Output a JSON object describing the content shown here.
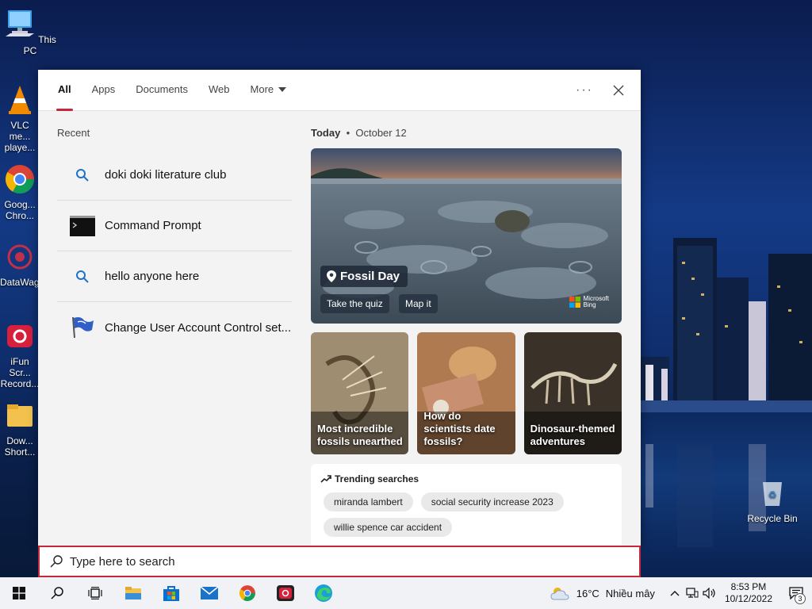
{
  "desktop": {
    "this_pc": "This PC",
    "vlc": "VLC me... playe...",
    "chrome": "Goog... Chro...",
    "datawag": "DataWag...",
    "ifun": "iFun Scr... Record...",
    "download": "Dow... Short...",
    "recycle_bin": "Recycle Bin"
  },
  "tabs": [
    {
      "label": "All"
    },
    {
      "label": "Apps"
    },
    {
      "label": "Documents"
    },
    {
      "label": "Web"
    },
    {
      "label": "More"
    }
  ],
  "recent": {
    "title": "Recent",
    "items": [
      {
        "label": "doki doki literature club",
        "icon": "search-icon"
      },
      {
        "label": "Command Prompt",
        "icon": "command-prompt-icon"
      },
      {
        "label": "hello anyone here",
        "icon": "search-icon"
      },
      {
        "label": "Change User Account Control set...",
        "icon": "uac-flag-icon"
      }
    ]
  },
  "today": {
    "label": "Today",
    "separator": "•",
    "date": "October 12"
  },
  "hero": {
    "title": "Fossil Day",
    "btn_quiz": "Take the quiz",
    "btn_map": "Map it",
    "bing_line1": "Microsoft",
    "bing_line2": "Bing"
  },
  "cards": [
    {
      "label": "Most incredible fossils unearthed"
    },
    {
      "label": "How do scientists date fossils?"
    },
    {
      "label": "Dinosaur-themed adventures"
    }
  ],
  "trending": {
    "title": "Trending searches",
    "items": [
      "miranda lambert",
      "social security increase 2023",
      "willie spence car accident"
    ]
  },
  "search": {
    "placeholder": "Type here to search"
  },
  "taskbar": {
    "temperature": "16°C",
    "weather": "Nhiều mây",
    "time": "8:53 PM",
    "date": "10/12/2022",
    "notifications": "3"
  },
  "colors": {
    "accent": "#c4283a",
    "panel_bg": "#f3f3f3"
  }
}
